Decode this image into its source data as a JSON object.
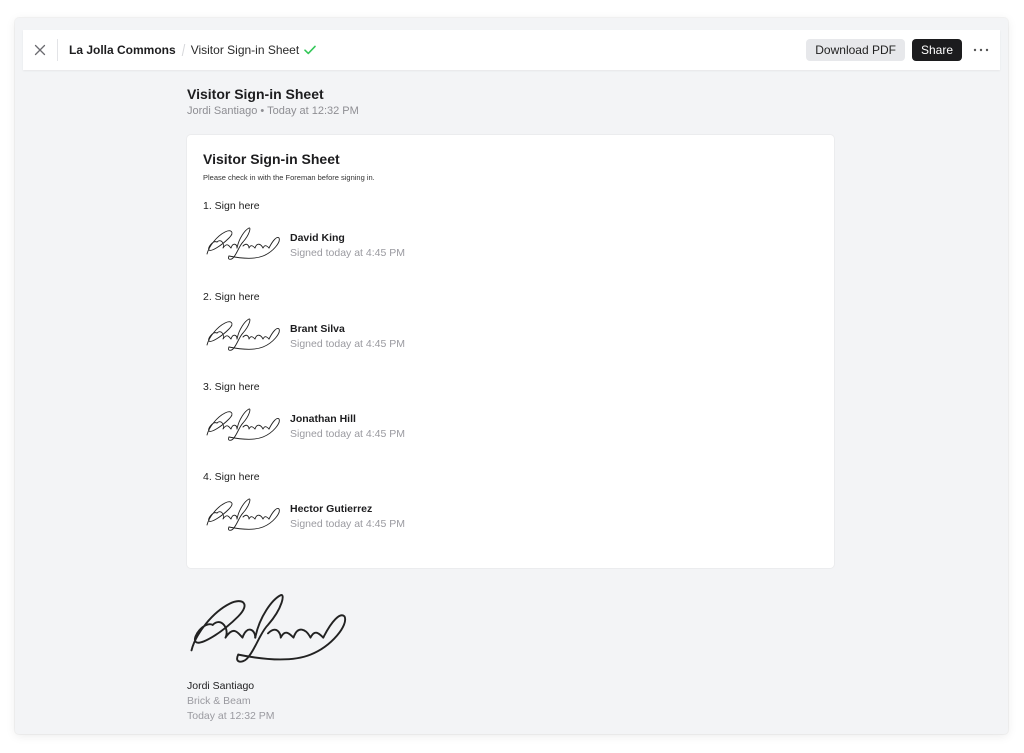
{
  "header": {
    "project": "La Jolla Commons",
    "document": "Visitor Sign-in Sheet",
    "download_label": "Download PDF",
    "share_label": "Share",
    "accent_check": "#34c759"
  },
  "doc": {
    "title": "Visitor Sign-in Sheet",
    "meta": "Jordi Santiago • Today at 12:32 PM"
  },
  "form": {
    "title": "Visitor Sign-in Sheet",
    "description": "Please check in with the Foreman before signing in.",
    "fields": [
      {
        "label": "1. Sign here",
        "name": "David King",
        "signed": "Signed today at 4:45 PM"
      },
      {
        "label": "2. Sign here",
        "name": "Brant Silva",
        "signed": "Signed today at 4:45 PM"
      },
      {
        "label": "3. Sign here",
        "name": "Jonathan Hill",
        "signed": "Signed today at 4:45 PM"
      },
      {
        "label": "4. Sign here",
        "name": "Hector Gutierrez",
        "signed": "Signed today at 4:45 PM"
      }
    ]
  },
  "footer": {
    "name": "Jordi Santiago",
    "company": "Brick & Beam",
    "time": "Today at 12:32 PM"
  }
}
